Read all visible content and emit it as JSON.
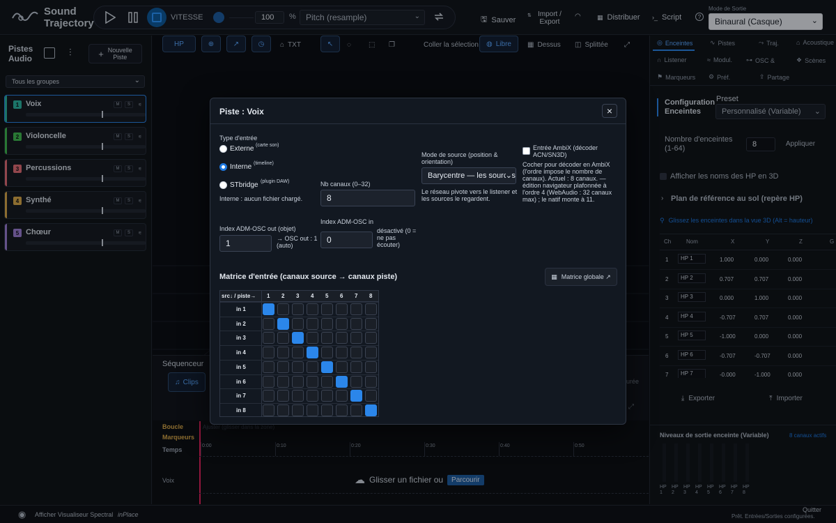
{
  "app": {
    "title_line1": "Sound",
    "title_line2": "Trajectory"
  },
  "transport": {
    "speed_label": "VITESSE",
    "speed_value": "100",
    "percent": "%",
    "pitch_mode": "Pitch (resample)"
  },
  "toolbar": {
    "save": "Sauver",
    "import_export_1": "Import /",
    "import_export_2": "Export",
    "distribute": "Distribuer",
    "script": "Script",
    "output_mode_label": "Mode de Sortie",
    "output_mode_value": "Binaural (Casque)"
  },
  "left": {
    "title1": "Pistes",
    "title2": "Audio",
    "new_track1": "Nouvelle",
    "new_track2": "Piste",
    "group_filter": "Tous les groupes",
    "tracks": [
      {
        "num": "1",
        "name": "Voix",
        "color": "#2bb3a0"
      },
      {
        "num": "2",
        "name": "Violoncelle",
        "color": "#3fb950"
      },
      {
        "num": "3",
        "name": "Percussions",
        "color": "#e06c75"
      },
      {
        "num": "4",
        "name": "Synthé",
        "color": "#d8a84a"
      },
      {
        "num": "5",
        "name": "Chœur",
        "color": "#9b7fd4"
      }
    ],
    "m": "M",
    "s": "S"
  },
  "center": {
    "tools": {
      "hp": "HP",
      "txt": "TXT",
      "paste": "Coller la sélection",
      "free": "Libre",
      "top": "Dessus",
      "split": "Splittée"
    },
    "sequencer": "Séquenceur",
    "clips": "Clips",
    "loop": "Boucle",
    "loop_hint": "Ajuster (glisser dans la zone)",
    "markers": "Marqueurs",
    "time": "Temps",
    "ticks": [
      "0:00",
      "0:10",
      "0:20",
      "0:30",
      "0:40",
      "0:50"
    ],
    "track_row": "Voix",
    "drop_text": "Glisser un fichier ou",
    "browse": "Parcourir",
    "duration_frag": "urée"
  },
  "right": {
    "tabs": {
      "speakers": "Enceintes",
      "tracks": "Pistes",
      "traj": "Traj.",
      "acoustic": "Acoustique",
      "listener": "Listener",
      "modul": "Modul.",
      "osc": "OSC &",
      "scenes": "Scènes",
      "markers": "Marqueurs",
      "prefs": "Préf.",
      "share": "Partage"
    },
    "config1": "Configuration",
    "config2": "Enceintes",
    "preset_label": "Preset",
    "preset_value": "Personnalisé (Variable)",
    "count_label1": "Nombre d'enceintes",
    "count_label2": "(1-64)",
    "count_value": "8",
    "apply": "Appliquer",
    "show_names": "Afficher les noms des HP en 3D",
    "ref_plane": "Plan de référence au sol (repère HP)",
    "drag_hint": "Glissez les enceintes dans la vue 3D (Alt = hauteur)",
    "table_headers": [
      "Ch",
      "Nom",
      "X",
      "Y",
      "Z",
      "G"
    ],
    "rows": [
      [
        "1",
        "HP 1",
        "1.000",
        "0.000",
        "0.000"
      ],
      [
        "2",
        "HP 2",
        "0.707",
        "0.707",
        "0.000"
      ],
      [
        "3",
        "HP 3",
        "0.000",
        "1.000",
        "0.000"
      ],
      [
        "4",
        "HP 4",
        "-0.707",
        "0.707",
        "0.000"
      ],
      [
        "5",
        "HP 5",
        "-1.000",
        "0.000",
        "0.000"
      ],
      [
        "6",
        "HP 6",
        "-0.707",
        "-0.707",
        "0.000"
      ],
      [
        "7",
        "HP 7",
        "-0.000",
        "-1.000",
        "0.000"
      ]
    ],
    "export": "Exporter",
    "import": "Importer",
    "levels_title": "Niveaux de sortie enceinte (Variable)",
    "levels_active": "8 canaux actifs",
    "meters": [
      {
        "a": "HP",
        "b": "1"
      },
      {
        "a": "HP",
        "b": "2"
      },
      {
        "a": "HP",
        "b": "3"
      },
      {
        "a": "HP",
        "b": "4"
      },
      {
        "a": "HP",
        "b": "5"
      },
      {
        "a": "HP",
        "b": "6"
      },
      {
        "a": "HP",
        "b": "7"
      },
      {
        "a": "HP",
        "b": "8"
      }
    ]
  },
  "bottom": {
    "spectral": "Afficher Visualiseur Spectral",
    "inplace": "inPlace",
    "quit": "Quitter",
    "status": "Prêt. Entrées/Sorties configurées."
  },
  "dialog": {
    "title": "Piste : Voix",
    "input_type": "Type d'entrée",
    "external": "Externe",
    "external_sup": "(carte son)",
    "internal": "Interne",
    "internal_sup": "(timeline)",
    "stbridge": "STbridge",
    "stbridge_sup": "(plugin DAW)",
    "internal_note": "Interne : aucun fichier chargé.",
    "channels_label": "Nb canaux (0–32)",
    "channels_value": "8",
    "source_mode_label": "Mode de source (position & orientation)",
    "source_mode_value": "Barycentre — les sources",
    "source_mode_note": "Le réseau pivote vers le listener et les sources le regardent.",
    "ambix_label": "Entrée AmbiX (décoder ACN/SN3D)",
    "ambix_note": "Cocher pour décoder en AmbiX (l'ordre impose le nombre de canaux). Actuel : 8 canaux. — édition navigateur plafonnée à l'ordre 4 (WebAudio : 32 canaux max) ; le natif monte à 11.",
    "adm_out_label": "Index ADM-OSC out (objet)",
    "adm_out_value": "1",
    "adm_out_note": "→ OSC out : 1 (auto)",
    "adm_in_label": "Index ADM-OSC in",
    "adm_in_value": "0",
    "adm_in_note": "désactivé (0 = ne pas écouter)",
    "matrix_title": "Matrice d'entrée (canaux source → canaux piste)",
    "global_matrix": "Matrice globale ↗",
    "corner": "src↓ / piste→",
    "cols": [
      "1",
      "2",
      "3",
      "4",
      "5",
      "6",
      "7",
      "8"
    ],
    "rows": [
      "in 1",
      "in 2",
      "in 3",
      "in 4",
      "in 5",
      "in 6",
      "in 7",
      "in 8"
    ],
    "active": [
      0,
      1,
      2,
      3,
      4,
      5,
      6,
      7
    ],
    "close": "×"
  }
}
